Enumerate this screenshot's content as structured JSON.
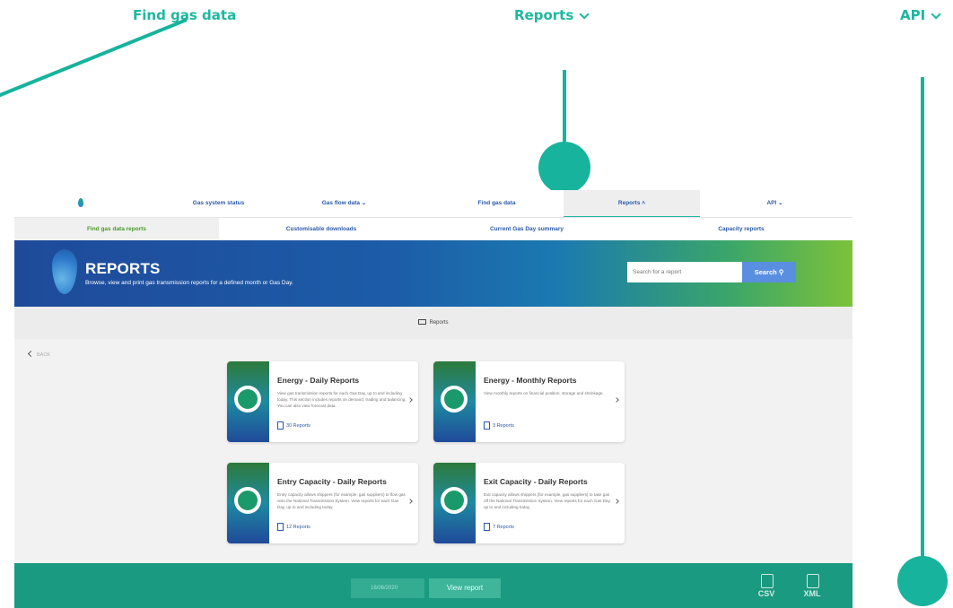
{
  "annotations": {
    "find_gas_data": "Find gas data",
    "reports": "Reports",
    "api": "API"
  },
  "nav": {
    "gas_system_status": "Gas system status",
    "gas_flow_data": "Gas flow data",
    "find_gas_data": "Find gas data",
    "reports": "Reports",
    "api": "API"
  },
  "subnav": {
    "find_reports": "Find gas data reports",
    "custom_downloads": "Customisable downloads",
    "current_summary": "Current Gas Day summary",
    "capacity_reports": "Capacity reports"
  },
  "hero": {
    "title": "REPORTS",
    "subtitle": "Browse, view and print gas transmission reports for a defined month or Gas Day.",
    "search_placeholder": "Search for a report",
    "search_button": "Search"
  },
  "breadcrumb": "Reports",
  "back": "BACK",
  "cards": [
    {
      "title": "Energy - Daily Reports",
      "desc": "View gas transmission reports for each Gas Day, up to and including today. This section includes reports on demand, trading and balancing. You can also view forecast data.",
      "count": "30 Reports"
    },
    {
      "title": "Energy - Monthly Reports",
      "desc": "View monthly reports on financial position, storage and shrinkage.",
      "count": "3 Reports"
    },
    {
      "title": "Entry Capacity - Daily Reports",
      "desc": "Entry capacity allows shippers (for example, gas suppliers) to flow gas onto the National Transmission System. View reports for each Gas Day, up to and including today.",
      "count": "12 Reports"
    },
    {
      "title": "Exit Capacity - Daily Reports",
      "desc": "Exit capacity allows shippers (for example, gas suppliers) to take gas off the National Transmission System. View reports for each Gas Day, up to and including today.",
      "count": "7 Reports"
    }
  ],
  "footer": {
    "date": "16/06/2020",
    "view_button": "View report",
    "csv": "CSV",
    "xml": "XML"
  },
  "colors": {
    "accent": "#17b39c",
    "nav_text": "#2a5aa8",
    "footer": "#1a9a80"
  }
}
